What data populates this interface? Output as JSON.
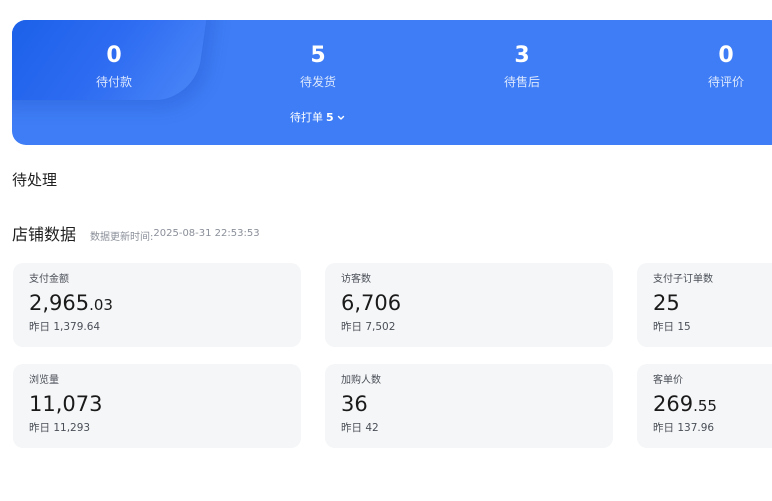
{
  "order_status": {
    "items": [
      {
        "value": "0",
        "label": "待付款"
      },
      {
        "value": "5",
        "label": "待发货"
      },
      {
        "value": "3",
        "label": "待售后"
      },
      {
        "value": "0",
        "label": "待评价"
      }
    ],
    "sub_pending": {
      "label": "待打单",
      "count": "5"
    },
    "colors": {
      "banner": "#3e7df5",
      "highlight": "#1a5fe8"
    }
  },
  "pending_section": {
    "title": "待处理"
  },
  "shop_data": {
    "title": "店铺数据",
    "update_label": "数据更新时间:",
    "update_time": "2025-08-31 22:53:53",
    "metrics": [
      {
        "label": "支付金额",
        "value_int": "2,965",
        "value_dec": ".03",
        "yesterday_label": "昨日",
        "yesterday_value": "1,379.64"
      },
      {
        "label": "访客数",
        "value_int": "6,706",
        "value_dec": "",
        "yesterday_label": "昨日",
        "yesterday_value": "7,502"
      },
      {
        "label": "支付子订单数",
        "value_int": "25",
        "value_dec": "",
        "yesterday_label": "昨日",
        "yesterday_value": "15"
      },
      {
        "label": "浏览量",
        "value_int": "11,073",
        "value_dec": "",
        "yesterday_label": "昨日",
        "yesterday_value": "11,293"
      },
      {
        "label": "加购人数",
        "value_int": "36",
        "value_dec": "",
        "yesterday_label": "昨日",
        "yesterday_value": "42"
      },
      {
        "label": "客单价",
        "value_int": "269",
        "value_dec": ".55",
        "yesterday_label": "昨日",
        "yesterday_value": "137.96"
      }
    ]
  }
}
